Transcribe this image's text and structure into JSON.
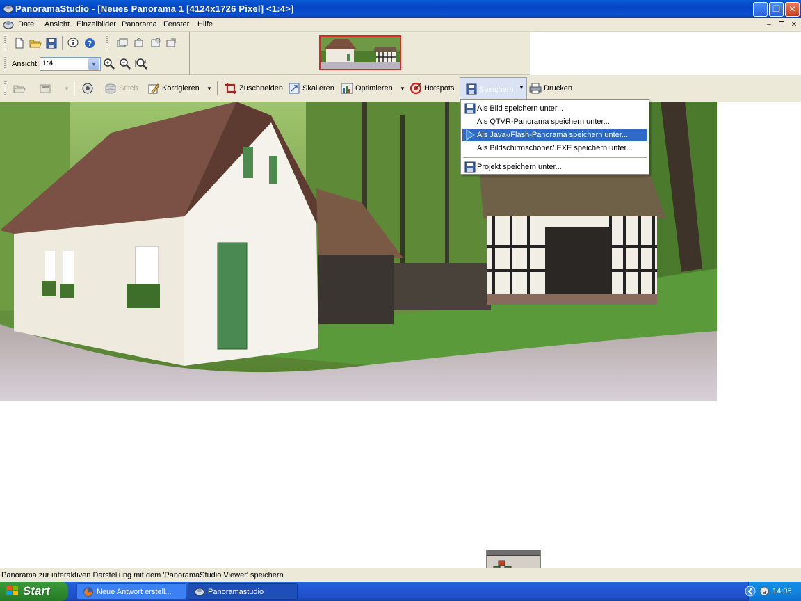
{
  "window": {
    "title": "PanoramaStudio - [Neues Panorama 1 [4124x1726 Pixel] <1:4>]",
    "controls": {
      "minimize": "_",
      "maximize": "❐",
      "close": "✕"
    }
  },
  "menubar": {
    "items": [
      "Datei",
      "Ansicht",
      "Einzelbilder",
      "Panorama",
      "Fenster",
      "Hilfe"
    ],
    "mdi_controls": {
      "minimize": "–",
      "restore": "❐",
      "close": "✕"
    }
  },
  "view_toolbar": {
    "zoom_label": "Ansicht:",
    "zoom_value": "1:4"
  },
  "main_toolbar": {
    "stitch": "Stitch",
    "korrigieren": "Korrigieren",
    "zuschneiden": "Zuschneiden",
    "skalieren": "Skalieren",
    "optimieren": "Optimieren",
    "hotspots": "Hotspots",
    "speichern": "Speichern",
    "drucken": "Drucken"
  },
  "save_menu": {
    "items": [
      {
        "label": "Als Bild speichern unter...",
        "icon": "floppy-icon"
      },
      {
        "label": "Als QTVR-Panorama speichern unter...",
        "icon": "none"
      },
      {
        "label": "Als Java-/Flash-Panorama speichern unter...",
        "icon": "play-arrow-icon",
        "selected": true
      },
      {
        "label": "Als Bildschirmschoner/.EXE speichern unter...",
        "icon": "none"
      },
      {
        "label": "Projekt speichern unter...",
        "icon": "floppy-icon"
      }
    ]
  },
  "statusbar": {
    "text": "Panorama zur interaktiven Darstellung mit dem 'PanoramaStudio Viewer' speichern"
  },
  "taskbar": {
    "start_label": "Start",
    "tasks": [
      {
        "label": "Neue Antwort erstell...",
        "icon": "firefox-icon",
        "active": false
      },
      {
        "label": "Panoramastudio",
        "icon": "panoramastudio-icon",
        "active": true
      }
    ],
    "clock": "14:05"
  },
  "colors": {
    "titlebar": "#0445c4",
    "menu_selected": "#316ac5",
    "thumb_border": "#d92626",
    "taskbar": "#245edb",
    "start_button": "#2f8b2f"
  }
}
